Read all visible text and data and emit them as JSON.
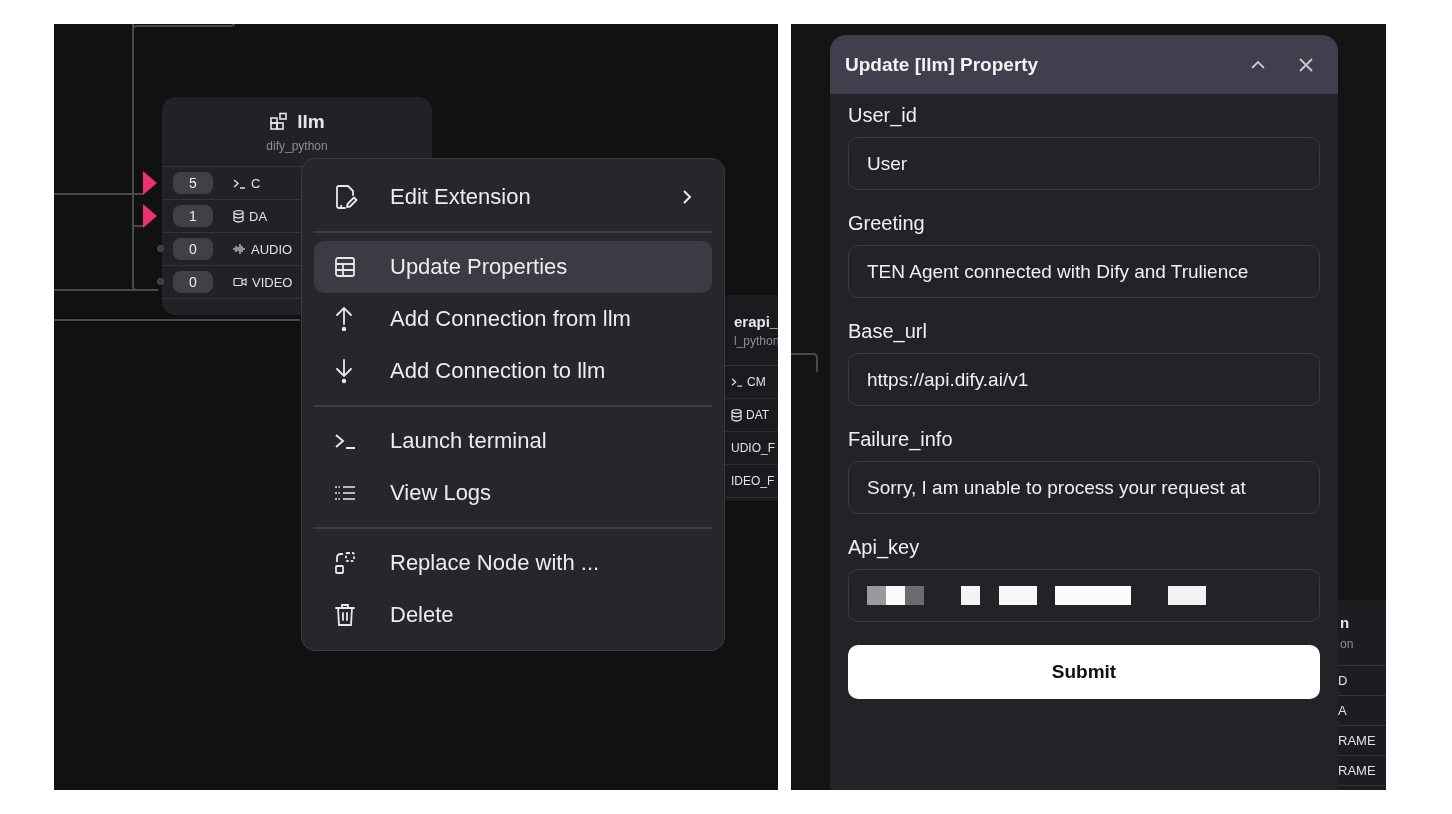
{
  "canvas": {
    "node": {
      "title": "llm",
      "subtitle": "dify_python",
      "ports": [
        {
          "count": "5",
          "label": "C",
          "connected": true
        },
        {
          "count": "1",
          "label": "DA",
          "connected": true
        },
        {
          "count": "0",
          "label": "AUDIO",
          "connected": false
        },
        {
          "count": "0",
          "label": "VIDEO",
          "connected": false
        }
      ]
    },
    "background_node": {
      "title": "erapi_",
      "subtitle": "l_python",
      "ports": [
        "CM",
        "DAT",
        "UDIO_F",
        "IDEO_F"
      ]
    }
  },
  "context_menu": {
    "groups": [
      [
        {
          "label": "Edit Extension",
          "has_submenu": true,
          "selected": false
        }
      ],
      [
        {
          "label": "Update Properties",
          "has_submenu": false,
          "selected": true
        },
        {
          "label": "Add Connection from llm",
          "has_submenu": false,
          "selected": false
        },
        {
          "label": "Add Connection to llm",
          "has_submenu": false,
          "selected": false
        }
      ],
      [
        {
          "label": "Launch terminal",
          "has_submenu": false,
          "selected": false
        },
        {
          "label": "View Logs",
          "has_submenu": false,
          "selected": false
        }
      ],
      [
        {
          "label": "Replace Node with ...",
          "has_submenu": false,
          "selected": false
        },
        {
          "label": "Delete",
          "has_submenu": false,
          "selected": false
        }
      ]
    ]
  },
  "dialog": {
    "title": "Update [llm] Property",
    "fields": [
      {
        "label": "User_id",
        "kind": "text",
        "value": "User"
      },
      {
        "label": "Greeting",
        "kind": "text",
        "value": "TEN Agent connected with Dify and Trulience"
      },
      {
        "label": "Base_url",
        "kind": "text",
        "value": "https://api.dify.ai/v1"
      },
      {
        "label": "Failure_info",
        "kind": "text",
        "value": "Sorry, I am unable to process your request at"
      },
      {
        "label": "Api_key",
        "kind": "redacted"
      }
    ],
    "submit": "Submit"
  },
  "right_background_node": {
    "title": "n",
    "subtitle": "on",
    "ports": [
      "D",
      "A",
      "RAME",
      "RAME"
    ]
  }
}
